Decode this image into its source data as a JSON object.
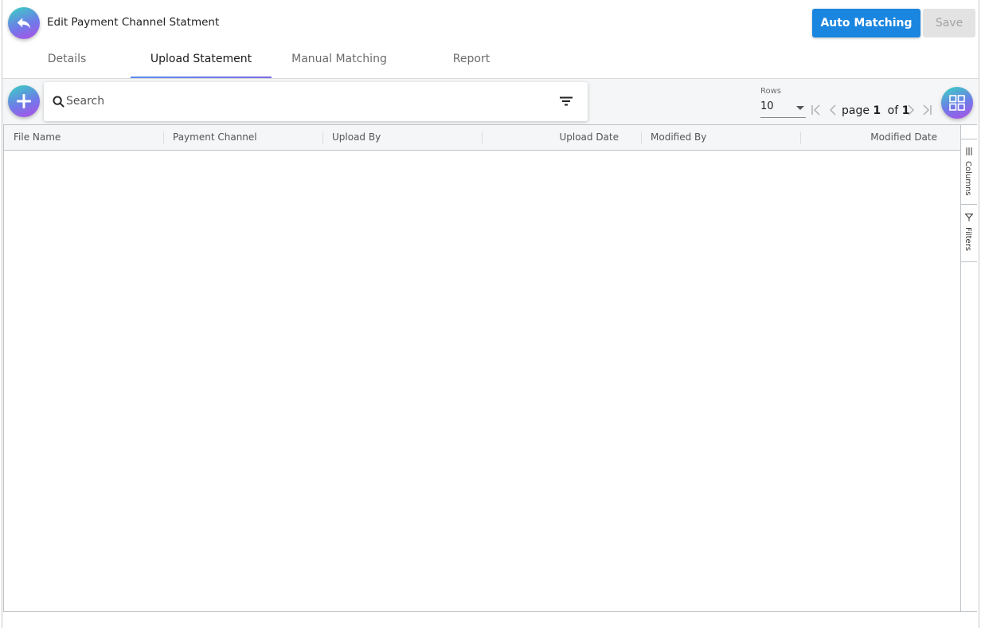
{
  "header": {
    "title": "Edit Payment Channel Statment",
    "auto_matching_label": "Auto Matching",
    "save_label": "Save"
  },
  "tabs": [
    {
      "label": "Details",
      "active": false
    },
    {
      "label": "Upload Statement",
      "active": true
    },
    {
      "label": "Manual Matching",
      "active": false
    },
    {
      "label": "Report",
      "active": false
    }
  ],
  "toolbar": {
    "search_placeholder": "Search",
    "search_value": "",
    "rows_label": "Rows",
    "rows_value": "10",
    "page_word": "page",
    "current_page": "1",
    "of_word": "of",
    "total_pages": "1"
  },
  "grid": {
    "columns": [
      "File Name",
      "Payment Channel",
      "Upload By",
      "Upload Date",
      "Modified By",
      "Modified Date"
    ],
    "rows": [],
    "side_tabs": [
      "Columns",
      "Filters"
    ]
  },
  "colors": {
    "primary": "#1a86e0",
    "gradient_start": "#37d3c2",
    "gradient_end": "#b04ee6",
    "disabled": "#e3e3e3"
  },
  "icons": {
    "back": "back-arrow-icon",
    "add": "plus-icon",
    "search": "search-icon",
    "filter": "filter-lines-icon",
    "grid": "grid-view-icon"
  }
}
